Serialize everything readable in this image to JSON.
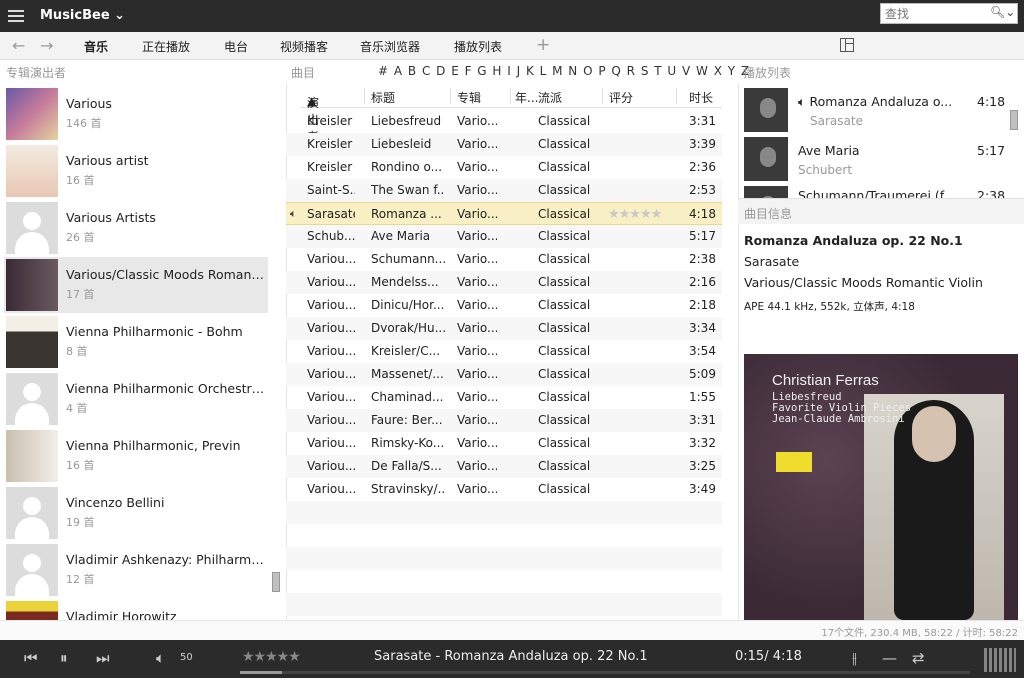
{
  "app": {
    "title": "MusicBee"
  },
  "window": {
    "minimize": "—",
    "maximize": "☐",
    "close": "✕"
  },
  "nav": {
    "back": "←",
    "forward": "→",
    "tabs": [
      "音乐",
      "正在播放",
      "电台",
      "视频播客",
      "音乐浏览器",
      "播放列表"
    ],
    "add": "+",
    "search_placeholder": "查找"
  },
  "left": {
    "caption": "专辑演出者",
    "artists": [
      {
        "name": "Various",
        "count": "146 首"
      },
      {
        "name": "Various artist",
        "count": "16 首"
      },
      {
        "name": "Various Artists",
        "count": "26 首"
      },
      {
        "name": "Various/Classic Moods Romantic Violin",
        "count": "17 首"
      },
      {
        "name": "Vienna Philharmonic - Bohm",
        "count": "8 首"
      },
      {
        "name": "Vienna Philharmonic Orchestra - Solti",
        "count": "4 首"
      },
      {
        "name": "Vienna Philharmonic, Previn",
        "count": "16 首"
      },
      {
        "name": "Vincenzo Bellini",
        "count": "19 首"
      },
      {
        "name": "Vladimir Ashkenazy: Philharmonia Orchestra",
        "count": "12 首"
      },
      {
        "name": "Vladimir Horowitz",
        "count": ""
      }
    ]
  },
  "tracks": {
    "caption": "曲目",
    "alphabet": "# A B C D E F G H I J K L M N O P Q R S T U V W X Y Z",
    "columns": {
      "artist": "演出者",
      "title": "标题",
      "album": "专辑",
      "year": "年...",
      "genre": "流派",
      "rating": "评分",
      "duration": "时长"
    },
    "rows": [
      {
        "artist": "Kreisler",
        "title": "Liebesfreud",
        "album": "Vario...",
        "genre": "Classical",
        "duration": "3:31"
      },
      {
        "artist": "Kreisler",
        "title": "Liebesleid",
        "album": "Vario...",
        "genre": "Classical",
        "duration": "3:39"
      },
      {
        "artist": "Kreisler",
        "title": "Rondino o...",
        "album": "Vario...",
        "genre": "Classical",
        "duration": "2:36"
      },
      {
        "artist": "Saint-S...",
        "title": "The Swan f...",
        "album": "Vario...",
        "genre": "Classical",
        "duration": "2:53"
      },
      {
        "artist": "Sarasate",
        "title": "Romanza ...",
        "album": "Vario...",
        "genre": "Classical",
        "duration": "4:18",
        "playing": true
      },
      {
        "artist": "Schub...",
        "title": "Ave Maria",
        "album": "Vario...",
        "genre": "Classical",
        "duration": "5:17"
      },
      {
        "artist": "Variou...",
        "title": "Schumann...",
        "album": "Vario...",
        "genre": "Classical",
        "duration": "2:38"
      },
      {
        "artist": "Variou...",
        "title": "Mendelss...",
        "album": "Vario...",
        "genre": "Classical",
        "duration": "2:16"
      },
      {
        "artist": "Variou...",
        "title": "Dinicu/Hor...",
        "album": "Vario...",
        "genre": "Classical",
        "duration": "2:18"
      },
      {
        "artist": "Variou...",
        "title": "Dvorak/Hu...",
        "album": "Vario...",
        "genre": "Classical",
        "duration": "3:34"
      },
      {
        "artist": "Variou...",
        "title": "Kreisler/C...",
        "album": "Vario...",
        "genre": "Classical",
        "duration": "3:54"
      },
      {
        "artist": "Variou...",
        "title": "Massenet/...",
        "album": "Vario...",
        "genre": "Classical",
        "duration": "5:09"
      },
      {
        "artist": "Variou...",
        "title": "Chaminad...",
        "album": "Vario...",
        "genre": "Classical",
        "duration": "1:55"
      },
      {
        "artist": "Variou...",
        "title": "Faure: Ber...",
        "album": "Vario...",
        "genre": "Classical",
        "duration": "3:31"
      },
      {
        "artist": "Variou...",
        "title": "Rimsky-Ko...",
        "album": "Vario...",
        "genre": "Classical",
        "duration": "3:32"
      },
      {
        "artist": "Variou...",
        "title": "De Falla/S...",
        "album": "Vario...",
        "genre": "Classical",
        "duration": "3:25"
      },
      {
        "artist": "Variou...",
        "title": "Stravinsky/...",
        "album": "Vario...",
        "genre": "Classical",
        "duration": "3:49"
      }
    ]
  },
  "playlist": {
    "caption": "播放列表",
    "items": [
      {
        "title": "Romanza Andaluza o...",
        "artist": "Sarasate",
        "duration": "4:18"
      },
      {
        "title": "Ave Maria",
        "artist": "Schubert",
        "duration": "5:17"
      },
      {
        "title": "Schumann/Traumerei (f...",
        "artist": "",
        "duration": "2:38"
      }
    ]
  },
  "trackinfo": {
    "caption": "曲目信息",
    "title": "Romanza Andaluza op. 22 No.1",
    "artist": "Sarasate",
    "album": "Various/Classic Moods Romantic Violin",
    "format": "APE 44.1 kHz, 552k, 立体声, 4:18"
  },
  "cover": {
    "artist": "Christian Ferras",
    "line1": "Liebesfreud",
    "line2": "Favorite Violin Pieces",
    "line3": "Jean-Claude Ambrosini"
  },
  "status": "17个文件, 230.4 MB, 58:22 /     计时: 58:22",
  "player": {
    "volume": "50",
    "now_playing": "Sarasate - Romanza Andaluza op. 22 No.1",
    "time": "0:15/ 4:18",
    "progress": 0.058
  }
}
